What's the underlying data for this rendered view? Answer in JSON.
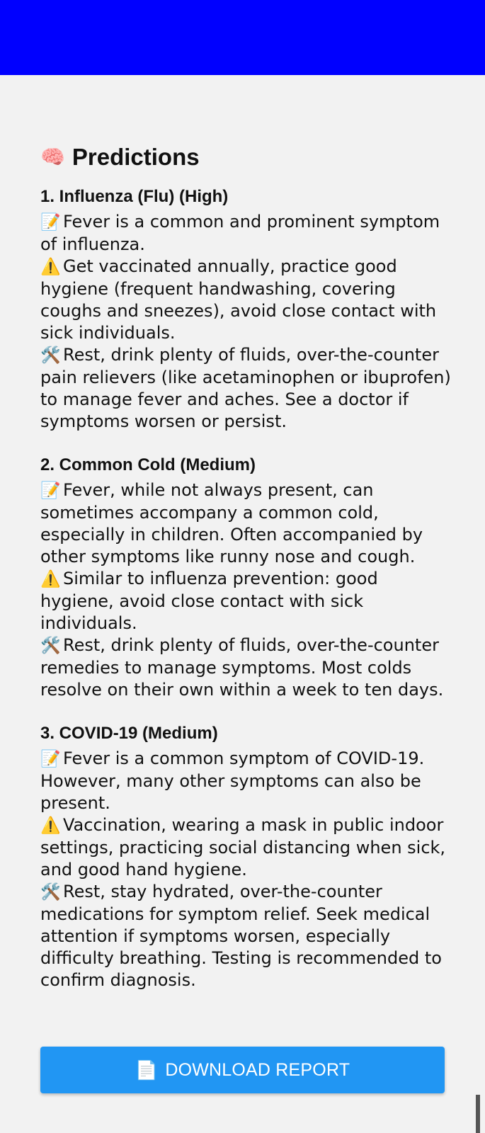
{
  "header": {
    "color": "#0000ff"
  },
  "predictions_section": {
    "icon": "brain-icon",
    "emoji": "🧠",
    "title": "Predictions",
    "items": [
      {
        "heading": "1. Influenza (Flu) (High)",
        "description": "Fever is a common and prominent symptom of influenza.",
        "prevention": "Get vaccinated annually, practice good hygiene (frequent handwashing, covering coughs and sneezes), avoid close contact with sick individuals.",
        "treatment": "Rest, drink plenty of fluids, over-the-counter pain relievers (like acetaminophen or ibuprofen) to manage fever and aches.  See a doctor if symptoms worsen or persist."
      },
      {
        "heading": "2. Common Cold (Medium)",
        "description": "Fever, while not always present, can sometimes accompany a common cold, especially in children.  Often accompanied by other symptoms like runny nose and cough.",
        "prevention": "Similar to influenza prevention: good hygiene, avoid close contact with sick individuals.",
        "treatment": "Rest, drink plenty of fluids, over-the-counter remedies to manage symptoms.  Most colds resolve on their own within a week to ten days."
      },
      {
        "heading": "3. COVID-19 (Medium)",
        "description": "Fever is a common symptom of COVID-19.  However, many other symptoms can also be present.",
        "prevention": "Vaccination, wearing a mask in public indoor settings, practicing social distancing when sick, and good hand hygiene.",
        "treatment": "Rest, stay hydrated, over-the-counter medications for symptom relief.  Seek medical attention if symptoms worsen, especially difficulty breathing.  Testing is recommended to confirm diagnosis."
      }
    ],
    "line_icons": {
      "description": "📝",
      "prevention": "⚠️",
      "treatment": "🛠️"
    }
  },
  "download_button": {
    "label": "DOWNLOAD REPORT",
    "icon": "document-icon",
    "emoji": "📄",
    "color": "#2196f3"
  }
}
